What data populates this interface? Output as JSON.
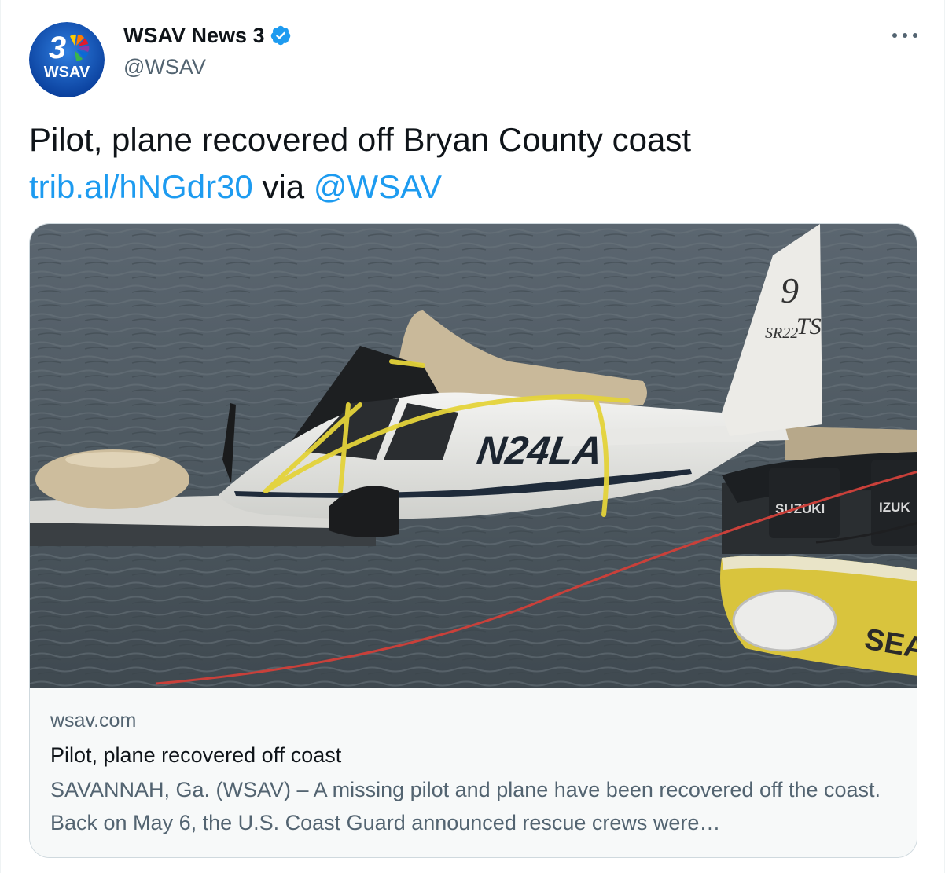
{
  "author": {
    "display_name": "WSAV News 3",
    "handle": "@WSAV",
    "verified": true,
    "avatar_logo": {
      "number": "3",
      "text": "WSAV"
    }
  },
  "tweet": {
    "text": "Pilot, plane recovered off Bryan County coast",
    "link": "trib.al/hNGdr30",
    "via": "via",
    "mention": "@WSAV"
  },
  "card": {
    "domain": "wsav.com",
    "title": "Pilot, plane recovered off coast",
    "description": "SAVANNAH, Ga. (WSAV) – A missing pilot and plane have been recovered off the coast. Back on May 6, the U.S. Coast Guard announced rescue crews were…",
    "image_markings": {
      "tail_model": "SR22",
      "tail_variant": "TS",
      "tail_number": "N24LA",
      "motor_brand": "SUZUKI",
      "motor_brand_partial": "IZUK",
      "boat_text": "SEA"
    }
  },
  "colors": {
    "accent": "#1d9bf0",
    "text_primary": "#0f1419",
    "text_secondary": "#536471",
    "border": "#cfd9de"
  },
  "icons": {
    "verified": "verified-badge-icon",
    "more": "more-options-icon"
  }
}
